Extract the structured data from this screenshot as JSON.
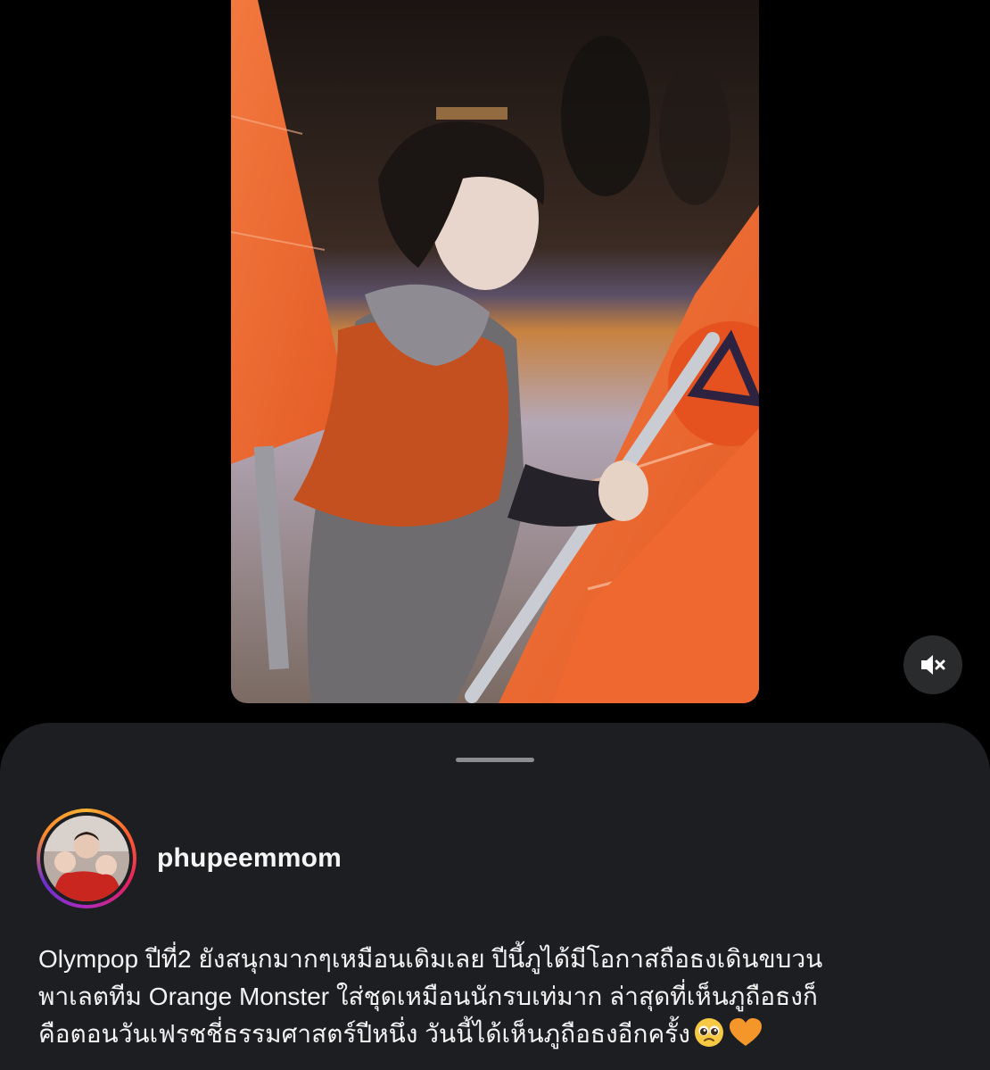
{
  "post": {
    "username": "phupeemmom",
    "caption_lines": [
      "Olympop ปีที่2 ยังสนุกมากๆเหมือนเดิมเลย ปีนี้ภูได้มีโอกาสถือธงเดินขบวน",
      "พาเลตทีม Orange Monster ใส่ชุดเหมือนนักรบเท่มาก ล่าสุดที่เห็นภูถือธงก็",
      "คือตอนวันเฟรชชี่ธรรมศาสตร์ปีหนึ่ง  วันนี้ได้เห็นภูถือธงอีกครั้ง"
    ],
    "caption_emojis": [
      "pleading-face-emoji",
      "orange-heart-emoji"
    ]
  },
  "media": {
    "icon": "mute-icon"
  },
  "colors": {
    "background": "#000000",
    "sheet": "#1c1e22",
    "flag_orange": "#f06a35",
    "text": "#f5f5f5"
  }
}
